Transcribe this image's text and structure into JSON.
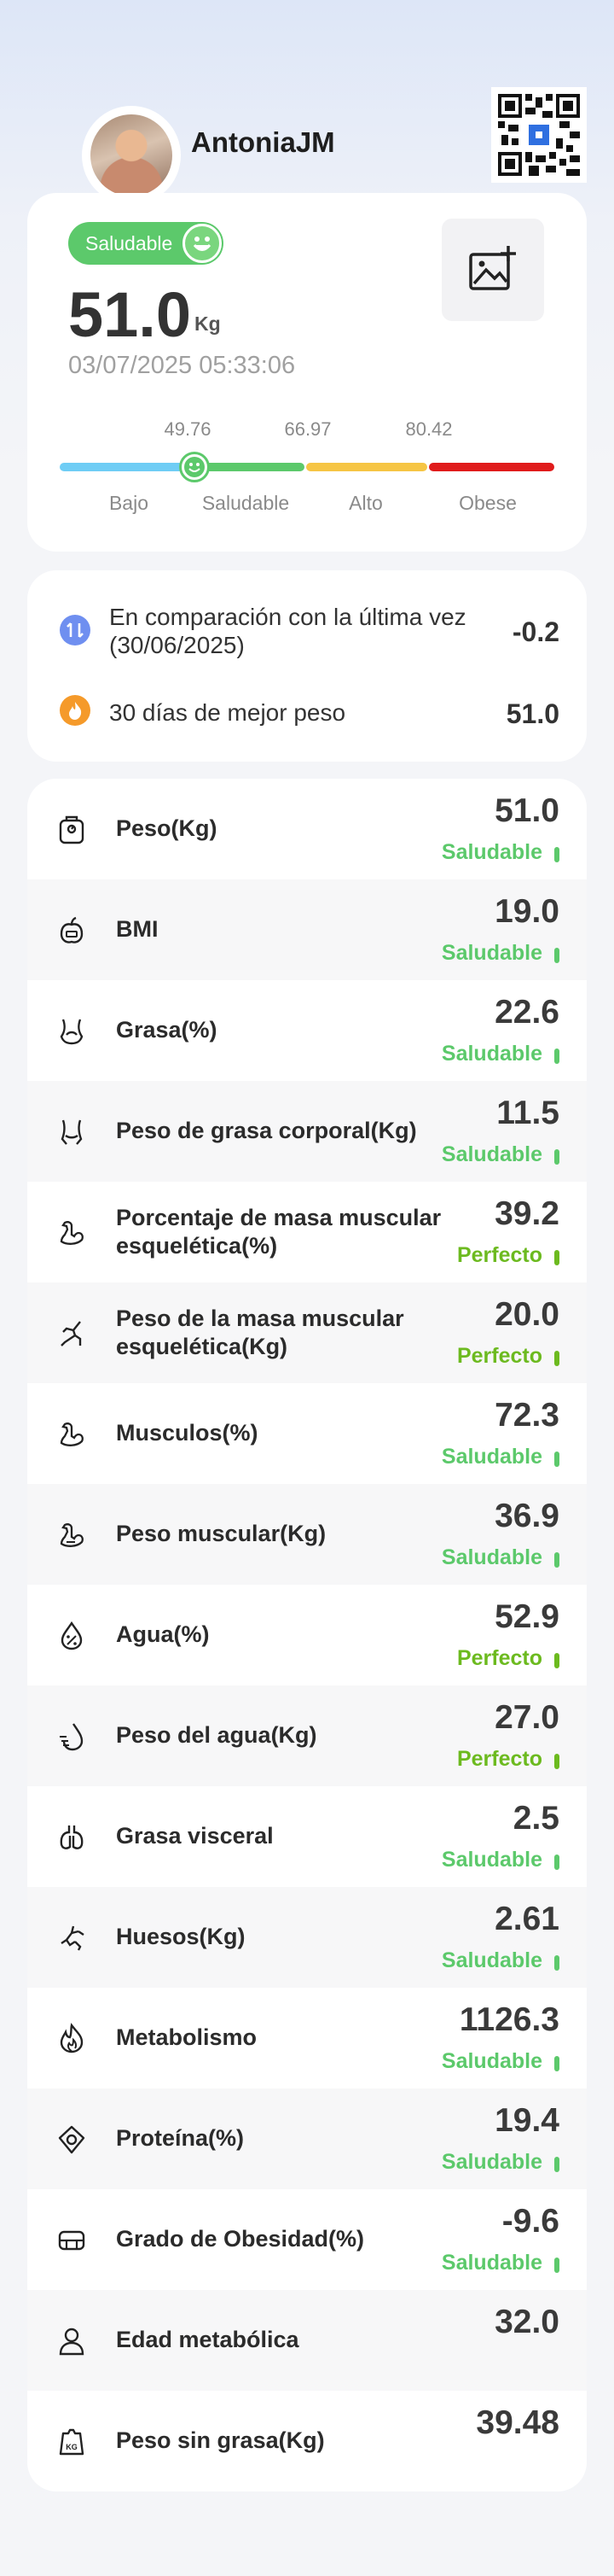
{
  "header": {
    "username": "AntoniaJM"
  },
  "summary": {
    "status_label": "Saludable",
    "weight": "51.0",
    "unit": "Kg",
    "datetime": "03/07/2025 05:33:06",
    "thresholds": [
      "49.76",
      "66.97",
      "80.42"
    ],
    "ranges": [
      "Bajo",
      "Saludable",
      "Alto",
      "Obese"
    ],
    "range_colors": [
      "#6fcdf5",
      "#5cc96b",
      "#f6c544",
      "#e01b1b"
    ],
    "status_color": "#5cc96b"
  },
  "compare": {
    "last_label": "En comparación con la última vez (30/06/2025)",
    "last_value": "-0.2",
    "best_label": "30 días de mejor peso",
    "best_value": "51.0"
  },
  "metrics": [
    {
      "icon": "scale-icon",
      "name": "Peso(Kg)",
      "value": "51.0",
      "status": "Saludable"
    },
    {
      "icon": "bmi-icon",
      "name": "BMI",
      "value": "19.0",
      "status": "Saludable"
    },
    {
      "icon": "body-fat-icon",
      "name": "Grasa(%)",
      "value": "22.6",
      "status": "Saludable"
    },
    {
      "icon": "body-fat-weight-icon",
      "name": "Peso de grasa corporal(Kg)",
      "value": "11.5",
      "status": "Saludable"
    },
    {
      "icon": "muscle-arm-icon",
      "name": "Porcentaje de masa muscular esquelética(%)",
      "value": "39.2",
      "status": "Perfecto"
    },
    {
      "icon": "skeletal-muscle-icon",
      "name": "Peso de la masa muscular esquelética(Kg)",
      "value": "20.0",
      "status": "Perfecto"
    },
    {
      "icon": "muscle-percent-icon",
      "name": "Musculos(%)",
      "value": "72.3",
      "status": "Saludable"
    },
    {
      "icon": "muscle-weight-icon",
      "name": "Peso muscular(Kg)",
      "value": "36.9",
      "status": "Saludable"
    },
    {
      "icon": "water-percent-icon",
      "name": "Agua(%)",
      "value": "52.9",
      "status": "Perfecto"
    },
    {
      "icon": "water-weight-icon",
      "name": "Peso del agua(Kg)",
      "value": "27.0",
      "status": "Perfecto"
    },
    {
      "icon": "visceral-fat-icon",
      "name": "Grasa visceral",
      "value": "2.5",
      "status": "Saludable"
    },
    {
      "icon": "bones-icon",
      "name": "Huesos(Kg)",
      "value": "2.61",
      "status": "Saludable"
    },
    {
      "icon": "metabolism-flame-icon",
      "name": "Metabolismo",
      "value": "1126.3",
      "status": "Saludable"
    },
    {
      "icon": "protein-icon",
      "name": "Proteína(%)",
      "value": "19.4",
      "status": "Saludable"
    },
    {
      "icon": "obesity-degree-icon",
      "name": "Grado de Obesidad(%)",
      "value": "-9.6",
      "status": "Saludable"
    },
    {
      "icon": "metabolic-age-icon",
      "name": "Edad metabólica",
      "value": "32.0",
      "status": ""
    },
    {
      "icon": "lean-mass-kg-icon",
      "name": "Peso sin grasa(Kg)",
      "value": "39.48",
      "status": ""
    }
  ],
  "status_colors": {
    "Saludable": "#5cc96b",
    "Perfecto": "#6cba1f"
  }
}
